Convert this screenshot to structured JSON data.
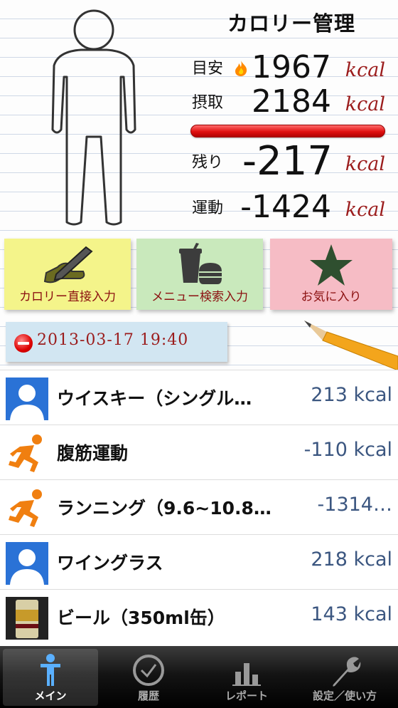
{
  "header": {
    "title": "カロリー管理",
    "target": {
      "label": "目安",
      "value": "1967",
      "unit": "kcal"
    },
    "intake": {
      "label": "摂取",
      "value": "2184",
      "unit": "kcal"
    },
    "remaining": {
      "label": "残り",
      "value": "-217",
      "unit": "kcal"
    },
    "exercise": {
      "label": "運動",
      "value": "-1424",
      "unit": "kcal"
    },
    "intake_progress": 1.0
  },
  "notes": [
    {
      "label": "カロリー直接入力",
      "icon": "pen-icon"
    },
    {
      "label": "メニュー検索入力",
      "icon": "fastfood-icon"
    },
    {
      "label": "お気に入り",
      "icon": "star-icon"
    }
  ],
  "date": {
    "text": "2013-03-17 19:40"
  },
  "entries": [
    {
      "name": "ウイスキー（シングル…",
      "kcal": "213 kcal",
      "icon": "person-placeholder-icon"
    },
    {
      "name": "腹筋運動",
      "kcal": "-110 kcal",
      "icon": "running-icon"
    },
    {
      "name": "ランニング（9.6~10.8…",
      "kcal": "-1314…",
      "icon": "running-icon"
    },
    {
      "name": "ワイングラス",
      "kcal": "218 kcal",
      "icon": "person-placeholder-icon"
    },
    {
      "name": "ビール（350ml缶）",
      "kcal": "143 kcal",
      "icon": "beer-can-photo"
    }
  ],
  "tabs": [
    {
      "label": "メイン",
      "icon": "person-icon",
      "active": true
    },
    {
      "label": "履歴",
      "icon": "clock-icon",
      "active": false
    },
    {
      "label": "レポート",
      "icon": "bar-chart-icon",
      "active": false
    },
    {
      "label": "設定／使い方",
      "icon": "wrench-icon",
      "active": false
    }
  ],
  "colors": {
    "unit": "#9b1c1c",
    "kcal_value": "#3b5680",
    "progress": "#e01010"
  }
}
